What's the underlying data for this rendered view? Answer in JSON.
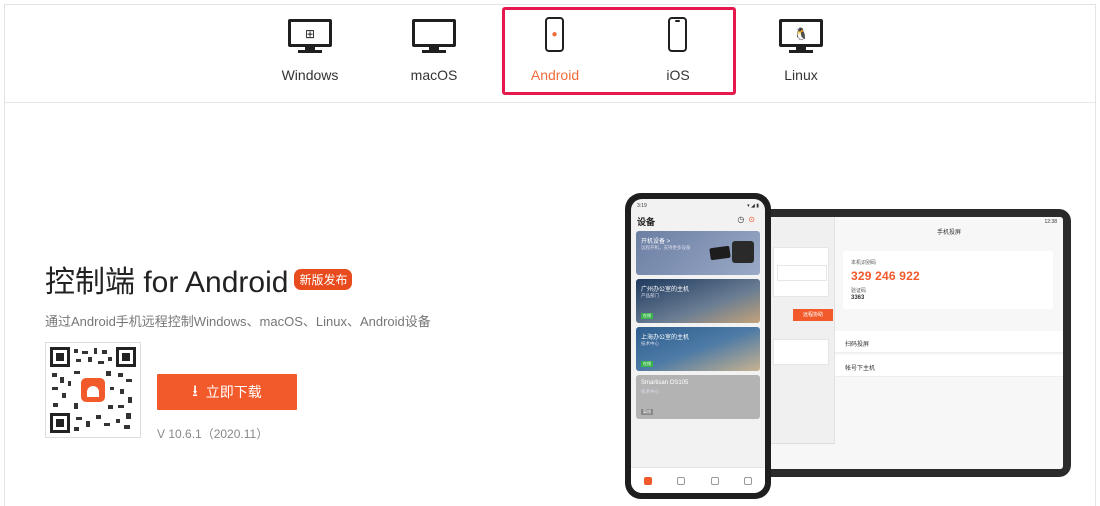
{
  "platform_tabs": [
    {
      "label": "Windows",
      "icon": "windows-monitor-icon",
      "glyph": "⊞"
    },
    {
      "label": "macOS",
      "icon": "mac-monitor-icon",
      "glyph": ""
    },
    {
      "label": "Android",
      "icon": "android-phone-icon",
      "glyph": "●",
      "active": true
    },
    {
      "label": "iOS",
      "icon": "ios-phone-icon",
      "glyph": ""
    },
    {
      "label": "Linux",
      "icon": "linux-monitor-icon",
      "glyph": "🐧"
    }
  ],
  "hero": {
    "title": "控制端 for Android",
    "badge": "新版发布",
    "subtitle": "通过Android手机远程控制Windows、macOS、Linux、Android设备",
    "download_label": "立即下载",
    "download_icon": "download-arrow-icon",
    "version": "V 10.6.1（2020.11）"
  },
  "phone_mock": {
    "time": "3:19",
    "title": "设备",
    "cards": [
      {
        "title": "开机设备 >",
        "sub": "远程开机，支持更多设备",
        "tag": ""
      },
      {
        "title": "广州办公室的主机",
        "sub": "产品部门",
        "tag": "在线"
      },
      {
        "title": "上海办公室的主机",
        "sub": "技术中心",
        "tag": "在线"
      },
      {
        "title": "Smartisan OS105",
        "sub": "技术中心",
        "tag": "离线"
      }
    ]
  },
  "tablet_mock": {
    "header": "手机投屏",
    "time": "12:38",
    "code_label": "本机识别码",
    "code": "329 246 922",
    "pwd_label": "验证码",
    "pwd": "3363",
    "connect_label": "远程协助",
    "rows": [
      "扫码投屏",
      "帐号下主机"
    ]
  },
  "colors": {
    "accent": "#f25a2b",
    "highlight_box": "#e5194d"
  }
}
